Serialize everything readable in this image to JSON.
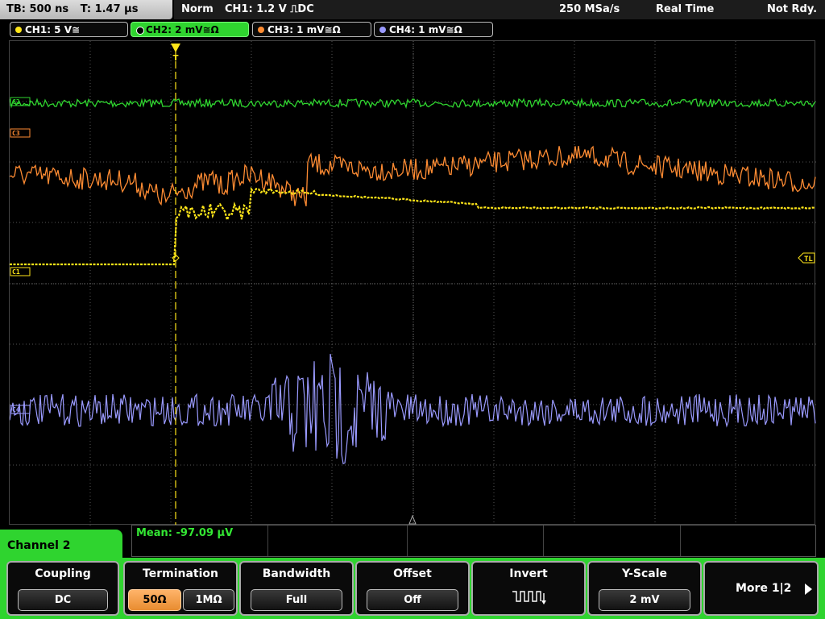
{
  "top_bar": {
    "timebase": "TB: 500 ns",
    "trigger_time": "T: 1.47 µs",
    "trigger_mode": "Norm",
    "trigger_info": "CH1: 1.2 V ⎍DC",
    "sample_rate": "250 MSa/s",
    "acq_mode": "Real Time",
    "status": "Not Rdy."
  },
  "channel_tabs": [
    {
      "label": "CH1: 5 V≅",
      "color": "#ffe619",
      "active": false
    },
    {
      "label": "CH2: 2 mV≅Ω",
      "color": "#2fd42f",
      "active": true
    },
    {
      "label": "CH3: 1 mV≅Ω",
      "color": "#ff8c33",
      "active": false
    },
    {
      "label": "CH4: 1 mV≅Ω",
      "color": "#9a9aff",
      "active": false
    }
  ],
  "display": {
    "trigger_marker": "T",
    "ch_markers": {
      "c2": "C2",
      "c3": "C3",
      "c1": "C1",
      "c4": "C4",
      "tl": "TL"
    },
    "colors": {
      "ch1": "#ffe619",
      "ch2": "#2fd42f",
      "ch3": "#ff8c33",
      "ch4": "#9a9aff",
      "grid": "#555555"
    }
  },
  "measurement": {
    "label": "Mean: -97.09 µV"
  },
  "menu": {
    "channel_title": "Channel 2",
    "softkeys": {
      "coupling": {
        "title": "Coupling",
        "value": "DC"
      },
      "termination": {
        "title": "Termination",
        "options": [
          "50Ω",
          "1MΩ"
        ],
        "selected": "50Ω"
      },
      "bandwidth": {
        "title": "Bandwidth",
        "value": "Full"
      },
      "offset": {
        "title": "Offset",
        "value": "Off"
      },
      "invert": {
        "title": "Invert",
        "icon": "invert-icon"
      },
      "yscale": {
        "title": "Y-Scale",
        "value": "2 mV"
      },
      "more": {
        "label": "More 1|2",
        "icon": "right-arrow-icon"
      }
    }
  }
}
